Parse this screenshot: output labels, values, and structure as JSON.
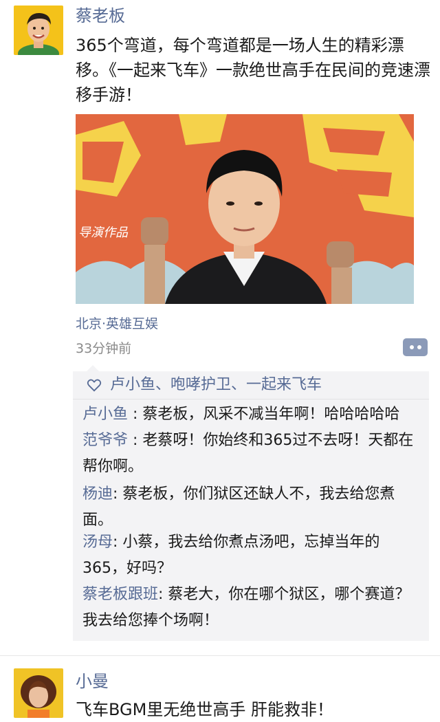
{
  "post1": {
    "author": "蔡老板",
    "text": "365个弯道，每个弯道都是一场人生的精彩漂移。《一起来飞车》一款绝世高手在民间的竞速漂移手游！",
    "location": "北京·英雄互娱",
    "time": "33分钟前",
    "photo_caption": "导演作品",
    "likes": "卢小鱼、咆哮护卫、一起来飞车",
    "comments": [
      {
        "author": "卢小鱼",
        "sep": " : ",
        "text": "蔡老板，风采不减当年啊！哈哈哈哈哈"
      },
      {
        "author": "范爷爷",
        "sep": " : ",
        "text": "老蔡呀！你始终和365过不去呀！天都在帮你啊。"
      },
      {
        "author": "杨迪",
        "sep": ": ",
        "text": "蔡老板，你们狱区还缺人不，我去给您煮面。"
      },
      {
        "author": "汤母",
        "sep": ": ",
        "text": "小蔡，我去给你煮点汤吧，忘掉当年的365，好吗？"
      },
      {
        "author": "蔡老板跟班",
        "sep": ": ",
        "text": "蔡老大，你在哪个狱区，哪个赛道？我去给您捧个场啊！"
      }
    ]
  },
  "post2": {
    "author": "小曼",
    "text": "飞车BGM里无绝世高手 肝能救非！"
  },
  "colors": {
    "link": "#576b95",
    "text": "#1a1a1a",
    "muted": "#8a8a8a",
    "comment_bg": "#f3f3f5",
    "more_button": "#8b9ab8"
  },
  "icons": {
    "like": "heart-outline-icon",
    "more": "more-dots-icon"
  }
}
